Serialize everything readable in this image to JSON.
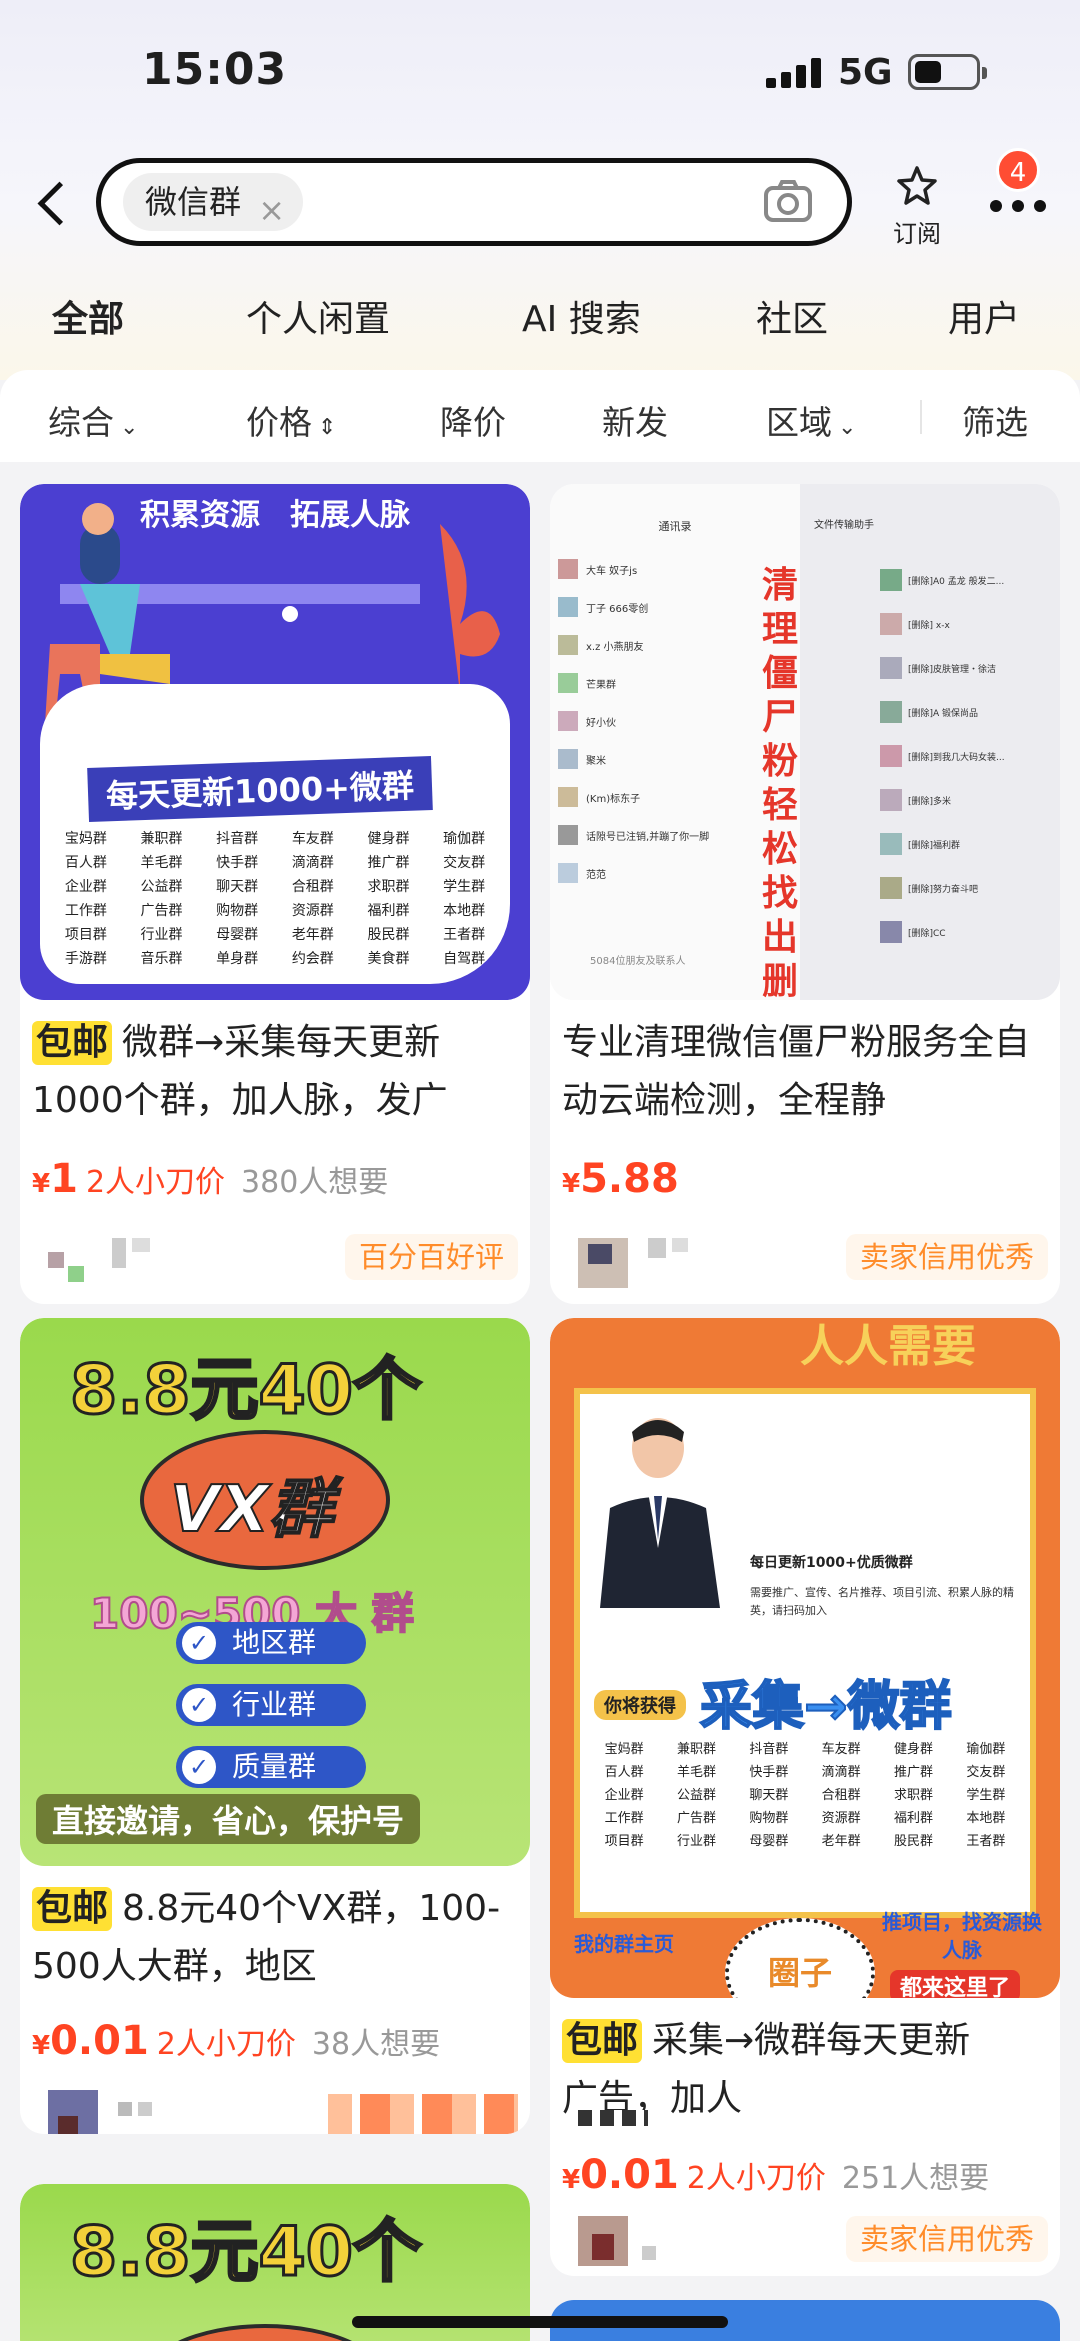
{
  "status_bar": {
    "time": "15:03",
    "network": "5G"
  },
  "search": {
    "query_chip": "微信群",
    "chip_clear": "×",
    "subscribe_label": "订阅",
    "more_badge": "4"
  },
  "category_tabs": [
    "全部",
    "个人闲置",
    "AI 搜索",
    "社区",
    "用户"
  ],
  "filters": {
    "comprehensive": "综合",
    "price": "价格",
    "price_drop": "降价",
    "new": "新发",
    "region": "区域",
    "screen": "筛选"
  },
  "cards": [
    {
      "image_text": {
        "banner": "积累资源　拓展人脉",
        "headline": "每天更新1000+微群",
        "words": [
          "宝妈群",
          "兼职群",
          "抖音群",
          "车友群",
          "健身群",
          "瑜伽群",
          "百人群",
          "羊毛群",
          "快手群",
          "滴滴群",
          "推广群",
          "交友群",
          "企业群",
          "公益群",
          "聊天群",
          "合租群",
          "求职群",
          "学生群",
          "工作群",
          "广告群",
          "购物群",
          "资源群",
          "福利群",
          "本地群",
          "项目群",
          "行业群",
          "母婴群",
          "老年群",
          "股民群",
          "王者群",
          "手游群",
          "音乐群",
          "单身群",
          "约会群",
          "美食群",
          "自驾群"
        ]
      },
      "tag": "包邮",
      "title": "微群→采集每天更新1000个群，加人脉，发广",
      "price": "1",
      "cut_text": "2人小刀价",
      "want_text": "380人想要",
      "seller_badge": "百分百好评"
    },
    {
      "image_text": {
        "left_header": "通讯录",
        "right_header": "文件传输助手",
        "vertical_text": "清理僵尸粉 轻松找出删除你的人",
        "contacts": [
          "大车 奴子js",
          "丁子 666零创",
          "x.z 小燕朋友",
          "芒果群",
          "好小伙",
          "聚米",
          "(Km)标东子",
          "话隙号已注销,并蹦了你一脚",
          "范范"
        ],
        "footer_count": "5084位朋友及联系人",
        "messages": [
          "[删除]A0 孟龙 般发二...",
          "[删除] x-x",
          "[删除]皮肤管理・徐洁",
          "[删除]A 锻保尚品",
          "[删除]到我几大码女装...",
          "[删除]多米",
          "[删除]福利群",
          "[删除]努力奋斗吧",
          "[删除]CC"
        ]
      },
      "title": "专业清理微信僵尸粉服务全自动云端检测，全程静",
      "price": "5.88",
      "seller_badge": "卖家信用优秀"
    },
    {
      "image_text": {
        "headline": "8.8元40个",
        "oval": "VX群",
        "sub": "100~500 大 群",
        "options": [
          "地区群",
          "行业群",
          "质量群"
        ],
        "footer": "直接邀请，省心，保护号"
      },
      "tag": "包邮",
      "title": "8.8元40个VX群，100-500人大群，地区",
      "price": "0.01",
      "cut_text": "2人小刀价",
      "want_text": "38人想要"
    },
    {
      "image_text": {
        "top": "人人需要",
        "update_line": "每日更新1000+优质微群",
        "desc": "需要推广、宣传、名片推荐、项目引流、积累人脉的精英，请扫码加入",
        "you_get": "你将获得",
        "headline": "采集→微群",
        "words": [
          "宝妈群",
          "兼职群",
          "抖音群",
          "车友群",
          "健身群",
          "瑜伽群",
          "百人群",
          "羊毛群",
          "快手群",
          "滴滴群",
          "推广群",
          "交友群",
          "企业群",
          "公益群",
          "聊天群",
          "合租群",
          "求职群",
          "学生群",
          "工作群",
          "广告群",
          "购物群",
          "资源群",
          "福利群",
          "本地群",
          "项目群",
          "行业群",
          "母婴群",
          "老年群",
          "股民群",
          "王者群"
        ],
        "my_group": "我的群主页",
        "circle": "圈子",
        "right_top": "推项目，找资源换人脉",
        "right_bottom": "都来这里了"
      },
      "tag": "包邮",
      "title": "采集→微群每天更新　　　　　　广告，加人",
      "price": "0.01",
      "cut_text": "2人小刀价",
      "want_text": "251人想要",
      "seller_badge": "卖家信用优秀"
    },
    {
      "image_text": {
        "headline": "8.8元40个"
      }
    }
  ],
  "colors": {
    "accent_yellow": "#ffe033",
    "price_red": "#ff4422",
    "badge_orange": "#ff8c2a"
  }
}
